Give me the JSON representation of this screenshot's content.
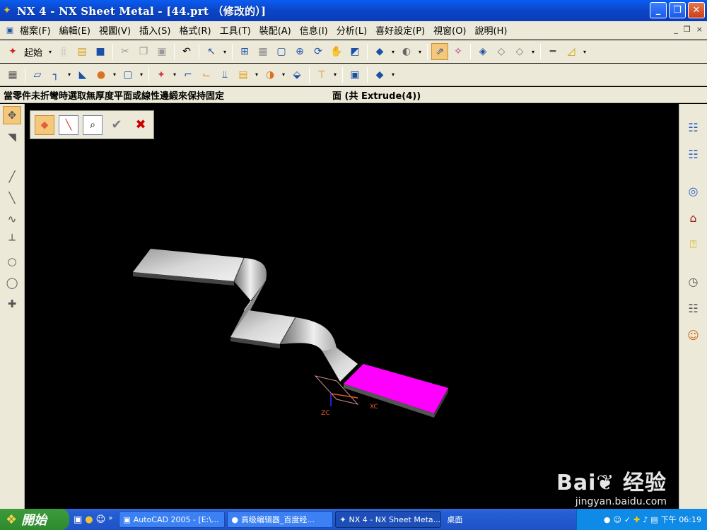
{
  "window": {
    "title": "NX 4 - NX Sheet Metal - [44.prt （修改的）]",
    "buttons": {
      "minimize": "_",
      "restore": "❒",
      "close": "✕"
    }
  },
  "menu": {
    "items": [
      "檔案(F)",
      "編輯(E)",
      "視圖(V)",
      "插入(S)",
      "格式(R)",
      "工具(T)",
      "裝配(A)",
      "信息(I)",
      "分析(L)",
      "喜好設定(P)",
      "視窗(O)",
      "說明(H)"
    ],
    "mdi": [
      "_",
      "❒",
      "×"
    ]
  },
  "toolbar": {
    "start_label": "起始"
  },
  "status": {
    "prompt": "當零件未折彎時選取無厚度平面或線性邊緞來保持固定",
    "selection": "面 (共 Extrude(4))"
  },
  "viewport": {
    "colors": {
      "background": "#000000",
      "part": "#c8c8c8",
      "highlight": "#ff00ff"
    },
    "axis_labels": {
      "zc": "ZC",
      "xc": "XC"
    }
  },
  "watermark": {
    "logo": "Bai❦ 经验",
    "url": "jingyan.baidu.com"
  },
  "taskbar": {
    "start": "開始",
    "tasks": [
      "AutoCAD 2005 - [E:\\...",
      "高级编辑器_百度经...",
      "NX 4 - NX Sheet Meta..."
    ],
    "desktop": "桌面",
    "clock": "下午 06:19"
  }
}
